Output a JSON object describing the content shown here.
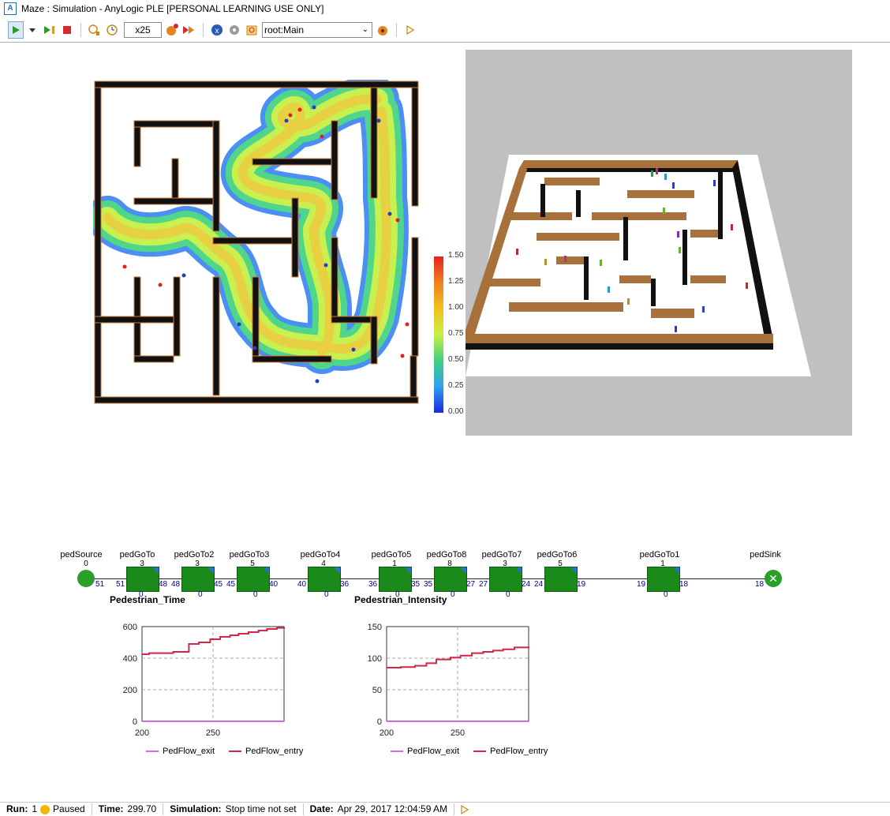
{
  "window": {
    "title": "Maze : Simulation - AnyLogic PLE [PERSONAL LEARNING USE ONLY]"
  },
  "toolbar": {
    "speed": "x25",
    "root_select": "root:Main",
    "icons": [
      "run-icon",
      "dropdown-icon",
      "step-icon",
      "stop-icon",
      "real-time-icon",
      "virtual-time-icon",
      "speed-down-icon",
      "speed-up-icon",
      "clear-icon",
      "settings-icon",
      "navigate-icon",
      "camera-icon",
      "next-icon"
    ]
  },
  "heatmap_legend": [
    "1.50",
    "1.25",
    "1.00",
    "0.75",
    "0.50",
    "0.25",
    "0.00"
  ],
  "flowchart": {
    "blocks": [
      {
        "name": "pedSource",
        "count": "0"
      },
      {
        "name": "pedGoTo",
        "count": "3"
      },
      {
        "name": "pedGoTo2",
        "count": "3"
      },
      {
        "name": "pedGoTo3",
        "count": "5"
      },
      {
        "name": "pedGoTo4",
        "count": "4"
      },
      {
        "name": "pedGoTo5",
        "count": "1"
      },
      {
        "name": "pedGoTo8",
        "count": "8"
      },
      {
        "name": "pedGoTo7",
        "count": "3"
      },
      {
        "name": "pedGoTo6",
        "count": "5"
      },
      {
        "name": "pedGoTo1",
        "count": "1"
      },
      {
        "name": "pedSink",
        "count": ""
      }
    ],
    "ports": [
      "51",
      "51",
      "48",
      "48",
      "45",
      "45",
      "40",
      "40",
      "36",
      "36",
      "35",
      "35",
      "27",
      "27",
      "24",
      "24",
      "19",
      "19",
      "18",
      "18"
    ],
    "bottom_counts": [
      "0",
      "0",
      "0",
      "0",
      "0",
      "0",
      "0",
      "0"
    ]
  },
  "charts": {
    "left_title": "Pedestrian_Time",
    "right_title": "Pedestrian_Intensity",
    "legend_exit": "PedFlow_exit",
    "legend_entry": "PedFlow_entry",
    "color_exit": "#c870d8",
    "color_entry": "#d2264a"
  },
  "chart_data": [
    {
      "type": "line",
      "title": "Pedestrian_Time",
      "xlim": [
        200,
        300
      ],
      "ylim": [
        0,
        600
      ],
      "x_ticks": [
        "200",
        "250"
      ],
      "y_ticks": [
        "0",
        "200",
        "400",
        "600"
      ],
      "series": [
        {
          "name": "PedFlow_entry",
          "x": [
            200,
            205,
            215,
            222,
            233,
            240,
            248,
            255,
            262,
            268,
            275,
            282,
            288,
            295,
            300
          ],
          "values": [
            425,
            432,
            432,
            440,
            490,
            500,
            520,
            535,
            545,
            555,
            565,
            575,
            585,
            592,
            595
          ]
        },
        {
          "name": "PedFlow_exit",
          "x": [
            200,
            300
          ],
          "values": [
            0,
            0
          ]
        }
      ]
    },
    {
      "type": "line",
      "title": "Pedestrian_Intensity",
      "xlim": [
        200,
        300
      ],
      "ylim": [
        0,
        150
      ],
      "x_ticks": [
        "200",
        "250"
      ],
      "y_ticks": [
        "0",
        "50",
        "100",
        "150"
      ],
      "series": [
        {
          "name": "PedFlow_entry",
          "x": [
            200,
            210,
            220,
            228,
            235,
            245,
            252,
            260,
            268,
            275,
            282,
            290,
            300
          ],
          "values": [
            85,
            86,
            88,
            92,
            98,
            101,
            104,
            108,
            110,
            112,
            114,
            117,
            118
          ]
        },
        {
          "name": "PedFlow_exit",
          "x": [
            200,
            300
          ],
          "values": [
            0,
            0
          ]
        }
      ]
    }
  ],
  "status": {
    "run_label": "Run:",
    "run_value": "1",
    "state": "Paused",
    "time_label": "Time:",
    "time_value": "299.70",
    "sim_label": "Simulation:",
    "sim_value": "Stop time not set",
    "date_label": "Date:",
    "date_value": "Apr 29, 2017 12:04:59 AM"
  }
}
